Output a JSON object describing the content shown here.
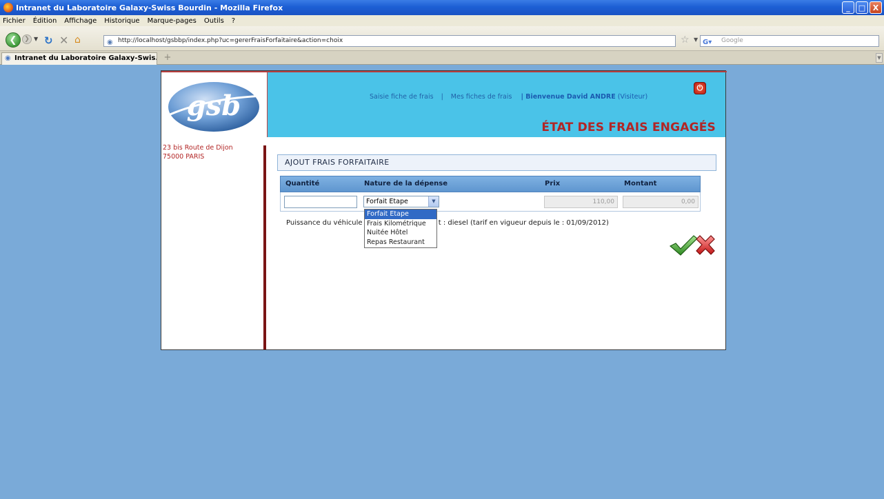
{
  "window": {
    "title": "Intranet du Laboratoire Galaxy-Swiss Bourdin - Mozilla Firefox",
    "minimize": "_",
    "maximize": "□",
    "close": "X"
  },
  "menu": {
    "items": [
      "Fichier",
      "Édition",
      "Affichage",
      "Historique",
      "Marque-pages",
      "Outils",
      "?"
    ]
  },
  "browser": {
    "url": "http://localhost/gsbbp/index.php?uc=gererFraisForfaitaire&action=choix",
    "search_placeholder": "Google",
    "tab_title": "Intranet du Laboratoire Galaxy-Swis...",
    "new_tab": "+"
  },
  "header": {
    "nav": {
      "saisie": "Saisie fiche de frais",
      "separator": "|",
      "mes_fiches": "Mes fiches de frais",
      "welcome_prefix": "| Bienvenue David ANDRE",
      "role": "(Visiteur)"
    },
    "title": "ÉTAT DES FRAIS ENGAGÉS",
    "logo_text": "gsb"
  },
  "sidebar": {
    "address_line1": "23 bis Route de Dijon",
    "address_line2": "75000 PARIS"
  },
  "form": {
    "section_title": "AJOUT FRAIS FORFAITAIRE",
    "columns": [
      "Quantité",
      "Nature de la dépense",
      "Prix",
      "Montant"
    ],
    "quantity_value": "",
    "selected_nature": "Forfait Etape",
    "price_value": "110,00",
    "amount_value": "0,00",
    "vehicle_text_left": "Puissance du véhicule : 5 C",
    "vehicle_text_right": "t : diesel (tarif en vigueur depuis le : 01/09/2012)",
    "dropdown_options": [
      "Forfait Etape",
      "Frais Kilométrique",
      "Nuitée Hôtel",
      "Repas Restaurant"
    ]
  },
  "colors": {
    "banner": "#4ac3e8",
    "title_red": "#b22525",
    "grid_header": "#6fa3d8",
    "background": "#7aaad8"
  },
  "icons": {
    "validate": "checkmark-icon",
    "cancel": "cross-icon",
    "logout": "power-icon"
  }
}
